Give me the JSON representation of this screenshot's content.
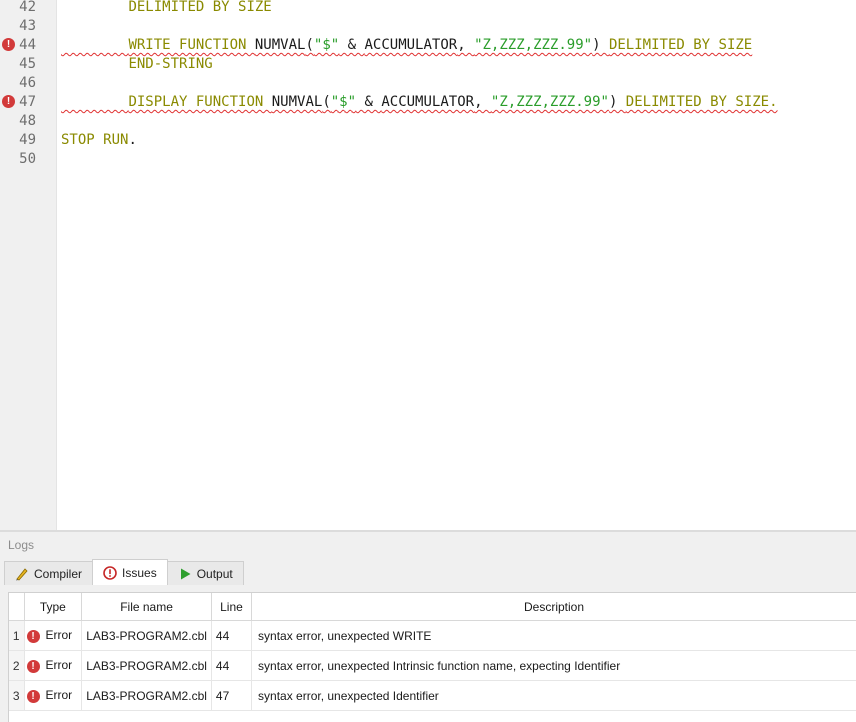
{
  "editor": {
    "lines": [
      {
        "num": "42",
        "error": false,
        "parts": [
          {
            "t": "        "
          },
          {
            "c": "kw",
            "t": "DELIMITED BY SIZE"
          }
        ]
      },
      {
        "num": "43",
        "error": false,
        "parts": []
      },
      {
        "num": "44",
        "error": true,
        "squiggle": true,
        "parts": [
          {
            "t": "        "
          },
          {
            "c": "kw",
            "t": "WRITE FUNCTION "
          },
          {
            "c": "id",
            "t": "NUMVAL"
          },
          {
            "c": "op",
            "t": "("
          },
          {
            "c": "str",
            "t": "\"$\""
          },
          {
            "c": "op",
            "t": " & "
          },
          {
            "c": "id",
            "t": "ACCUMULATOR"
          },
          {
            "c": "op",
            "t": ", "
          },
          {
            "c": "str",
            "t": "\"Z,ZZZ,ZZZ.99\""
          },
          {
            "c": "op",
            "t": ") "
          },
          {
            "c": "kw",
            "t": "DELIMITED BY SIZE"
          }
        ]
      },
      {
        "num": "45",
        "error": false,
        "parts": [
          {
            "t": "        "
          },
          {
            "c": "kw",
            "t": "END-STRING"
          }
        ]
      },
      {
        "num": "46",
        "error": false,
        "parts": []
      },
      {
        "num": "47",
        "error": true,
        "squiggle": true,
        "parts": [
          {
            "t": "        "
          },
          {
            "c": "kw",
            "t": "DISPLAY FUNCTION "
          },
          {
            "c": "id",
            "t": "NUMVAL"
          },
          {
            "c": "op",
            "t": "("
          },
          {
            "c": "str",
            "t": "\"$\""
          },
          {
            "c": "op",
            "t": " & "
          },
          {
            "c": "id",
            "t": "ACCUMULATOR"
          },
          {
            "c": "op",
            "t": ", "
          },
          {
            "c": "str",
            "t": "\"Z,ZZZ,ZZZ.99\""
          },
          {
            "c": "op",
            "t": ") "
          },
          {
            "c": "kw",
            "t": "DELIMITED BY SIZE."
          }
        ]
      },
      {
        "num": "48",
        "error": false,
        "parts": []
      },
      {
        "num": "49",
        "error": false,
        "parts": [
          {
            "c": "kw",
            "t": "STOP RUN"
          },
          {
            "c": "op",
            "t": "."
          }
        ]
      },
      {
        "num": "50",
        "error": false,
        "parts": []
      }
    ]
  },
  "logs": {
    "title": "Logs",
    "tabs": [
      {
        "label": "Compiler",
        "icon": "compiler-icon"
      },
      {
        "label": "Issues",
        "icon": "issues-icon"
      },
      {
        "label": "Output",
        "icon": "output-icon"
      }
    ],
    "active_tab": "Issues",
    "columns": {
      "type": "Type",
      "file": "File name",
      "line": "Line",
      "description": "Description"
    },
    "issues": [
      {
        "n": "1",
        "type": "Error",
        "file": "LAB3-PROGRAM2.cbl",
        "line": "44",
        "description": "syntax error, unexpected WRITE"
      },
      {
        "n": "2",
        "type": "Error",
        "file": "LAB3-PROGRAM2.cbl",
        "line": "44",
        "description": "syntax error, unexpected Intrinsic function name, expecting Identifier"
      },
      {
        "n": "3",
        "type": "Error",
        "file": "LAB3-PROGRAM2.cbl",
        "line": "47",
        "description": "syntax error, unexpected Identifier"
      }
    ]
  },
  "colors": {
    "keyword": "#8a8a00",
    "string": "#2a9d2a",
    "error": "#d23a3a"
  }
}
